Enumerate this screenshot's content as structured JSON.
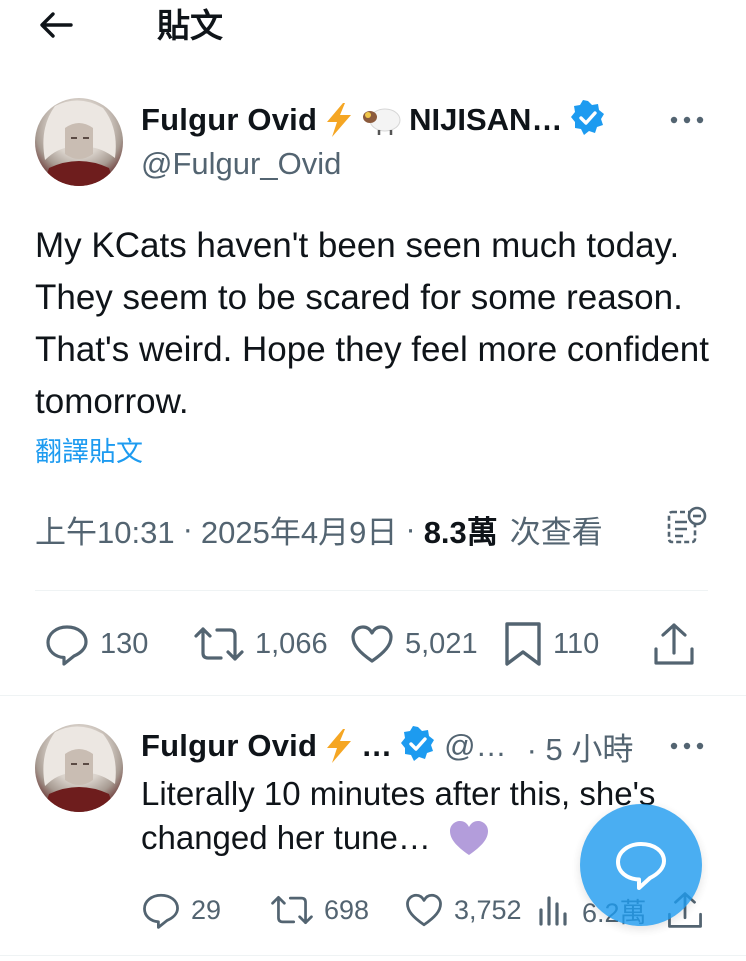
{
  "header": {
    "title": "貼文"
  },
  "tweet": {
    "author": {
      "name": "Fulgur Ovid",
      "name_suffix": "NIJISAN…",
      "handle": "@Fulgur_Ovid",
      "emojis": [
        "lightning-emoji",
        "sheep-emoji"
      ]
    },
    "text": "My KCats haven't been seen much today. They seem to be scared for some reason. That's weird. Hope they feel more confident tomorrow.",
    "translate_label": "翻譯貼文",
    "time": "上午10:31",
    "date": "2025年4月9日",
    "separator": "·",
    "views_count": "8.3萬",
    "views_label": "次查看",
    "stats": {
      "replies": "130",
      "retweets": "1,066",
      "likes": "5,021",
      "bookmarks": "110"
    }
  },
  "reply": {
    "author": {
      "name": "Fulgur Ovid",
      "truncation": "…",
      "handle": "@…",
      "time": "· 5 小時"
    },
    "text": "Literally 10 minutes after this, she's changed her tune…",
    "stats": {
      "replies": "29",
      "retweets": "698",
      "likes": "3,752",
      "views": "6.2萬"
    }
  },
  "colors": {
    "accent": "#1d9bf0",
    "text_primary": "#0f1419",
    "text_secondary": "#536471",
    "divider": "#eff3f4",
    "emoji_heart": "#b39ddb"
  },
  "icons": {
    "back": "arrow-left-icon",
    "more": "more-icon",
    "verified": "verified-badge-icon",
    "reply": "reply-icon",
    "retweet": "retweet-icon",
    "like": "heart-icon",
    "bookmark": "bookmark-icon",
    "share": "share-icon",
    "analytics": "analytics-icon",
    "compose": "compose-icon"
  }
}
